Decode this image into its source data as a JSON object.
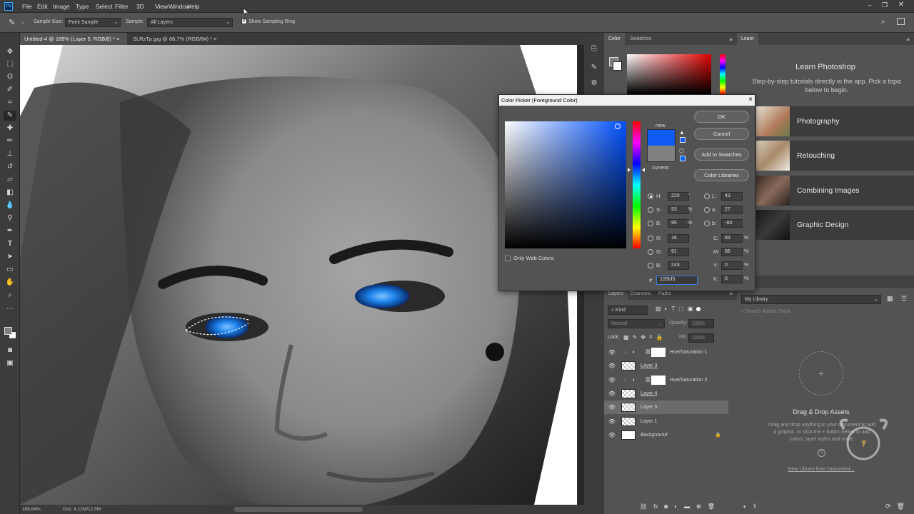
{
  "menubar": {
    "logo": "Ps",
    "items": [
      "File",
      "Edit",
      "Image",
      "Type",
      "Select",
      "Filter",
      "3D",
      "View",
      "Window",
      "Help"
    ]
  },
  "options": {
    "sample_size_label": "Sample Size:",
    "sample_size_value": "Point Sample",
    "sample_label": "Sample:",
    "sample_value": "All Layers",
    "sampling_ring_label": "Show Sampling Ring",
    "sampling_ring_checked": true
  },
  "doc_tabs": [
    {
      "label": "Untitled-4 @ 189% (Layer 5, RGB/8) *",
      "close": "×",
      "active": true
    },
    {
      "label": "SLRzTp.jpg @ 66,7% (RGB/8#) *",
      "close": "×",
      "active": false
    }
  ],
  "status": {
    "zoom": "188,64%",
    "doc": "Doc: 4,12M/12,5M"
  },
  "color_panel": {
    "tabs": [
      "Color",
      "Swatches"
    ]
  },
  "learn": {
    "tab": "Learn",
    "title": "Learn Photoshop",
    "desc": "Step-by-step tutorials directly in the app. Pick a topic below to begin.",
    "cards": [
      {
        "label": "Photography",
        "arrow": ">"
      },
      {
        "label": "Retouching",
        "arrow": ">"
      },
      {
        "label": "Combining Images",
        "arrow": ">"
      },
      {
        "label": "Graphic Design",
        "arrow": ">"
      }
    ]
  },
  "layers_panel": {
    "tabs": [
      "Layers",
      "Channels",
      "Paths"
    ],
    "kind_label": "Kind",
    "blend_mode": "Normal",
    "opacity_label": "Opacity:",
    "opacity_value": "100%",
    "lock_label": "Lock:",
    "fill_label": "Fill:",
    "fill_value": "100%",
    "layers": [
      {
        "name": "Hue/Saturation 1",
        "type": "adjustment",
        "selected": false
      },
      {
        "name": "Layer 3",
        "type": "pixel",
        "selected": false
      },
      {
        "name": "Hue/Saturation 2",
        "type": "adjustment",
        "selected": false
      },
      {
        "name": "Layer 4",
        "type": "pixel",
        "selected": false
      },
      {
        "name": "Layer 5",
        "type": "pixel",
        "selected": true
      },
      {
        "name": "Layer 1",
        "type": "pixel",
        "selected": false
      },
      {
        "name": "Background",
        "type": "background",
        "selected": false
      }
    ]
  },
  "libraries": {
    "library_select": "My Library",
    "search_placeholder": "Search Adobe Stock",
    "drop_title": "Drag & Drop Assets",
    "drop_desc": "Drag and drop anything in your document to add a graphic, or click the + button below to add colors, layer styles and more.",
    "new_library_link": "New Library from Document..."
  },
  "color_picker": {
    "title": "Color Picker (Foreground Color)",
    "close": "×",
    "new_label": "new",
    "current_label": "current",
    "new_color": "#105bf3",
    "current_color": "#808080",
    "ok_label": "OK",
    "cancel_label": "Cancel",
    "add_swatches_label": "Add to Swatches",
    "color_libraries_label": "Color Libraries",
    "only_web_label": "Only Web Colors",
    "hsb": [
      {
        "label": "H:",
        "value": "220",
        "unit": "°",
        "selected": true
      },
      {
        "label": "S:",
        "value": "93",
        "unit": "%",
        "selected": false
      },
      {
        "label": "B:",
        "value": "95",
        "unit": "%",
        "selected": false
      }
    ],
    "rgb": [
      {
        "label": "R:",
        "value": "16"
      },
      {
        "label": "G:",
        "value": "91"
      },
      {
        "label": "B:",
        "value": "243"
      }
    ],
    "lab": [
      {
        "label": "L:",
        "value": "43"
      },
      {
        "label": "a:",
        "value": "27"
      },
      {
        "label": "b:",
        "value": "-83"
      }
    ],
    "cmyk": [
      {
        "label": "C:",
        "value": "83",
        "unit": "%"
      },
      {
        "label": "M:",
        "value": "66",
        "unit": "%"
      },
      {
        "label": "Y:",
        "value": "0",
        "unit": "%"
      },
      {
        "label": "K:",
        "value": "0",
        "unit": "%"
      }
    ],
    "hex_label": "#",
    "hex_value": "105bf3"
  }
}
